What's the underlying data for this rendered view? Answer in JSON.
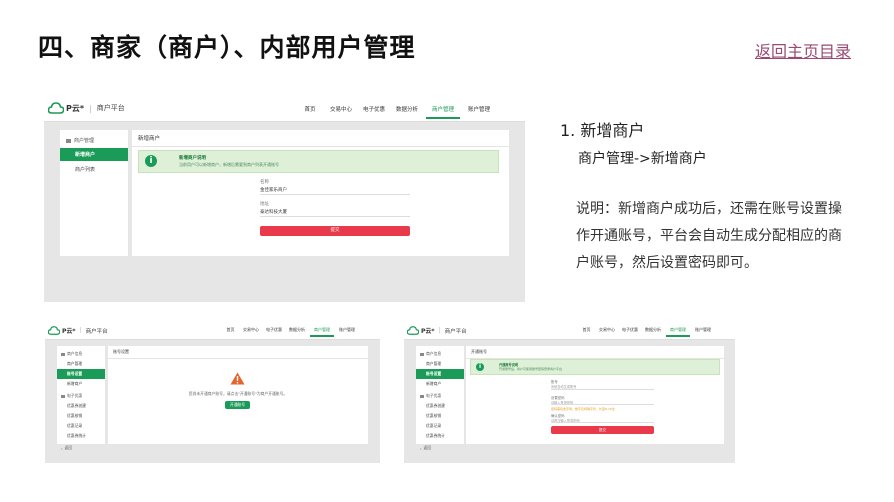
{
  "slide": {
    "title": "四、商家（商户）、内部用户管理",
    "back_link": "返回主页目录"
  },
  "app": {
    "logo": "P云*",
    "platform": "商户平台"
  },
  "top_nav": [
    "首页",
    "交易中心",
    "电子优惠",
    "数据分析",
    "商户管理",
    "账户管理"
  ],
  "top_nav_active": 4,
  "shot_main": {
    "sidebar_group": "商户管理",
    "sidebar_items": [
      "新增商户",
      "商户列表"
    ],
    "active_item": 0,
    "panel_title": "新增商户",
    "notice_title": "新增商户说明",
    "notice_desc": "当前用户可以新增商户，新增后需要到商户列表开通账号",
    "fields": [
      {
        "label": "名称",
        "value": "金佳家乐商户"
      },
      {
        "label": "地址",
        "value": "泰达科技大厦"
      }
    ],
    "submit_label": "提交"
  },
  "shot_left": {
    "sidebar_group": "商户信息",
    "sidebar_items": [
      "商户管理",
      "账号设置",
      "新增商户"
    ],
    "active_item": 1,
    "sidebar_group2": "电子优惠",
    "sidebar_items2": [
      "优惠券创建",
      "优惠核销",
      "优惠记录",
      "优惠券统计"
    ],
    "sidebar_footer": "返回",
    "panel_title": "账号设置",
    "warning_text": "您尚未开通商户账号，请点击\"开通账号\"为商户开通账号。",
    "button_label": "开通账号"
  },
  "shot_right": {
    "sidebar_group": "商户信息",
    "sidebar_items": [
      "商户管理",
      "账号设置",
      "新增商户"
    ],
    "active_item": 1,
    "sidebar_group2": "电子优惠",
    "sidebar_items2": [
      "优惠券创建",
      "优惠核销",
      "优惠记录",
      "优惠券统计"
    ],
    "sidebar_footer": "返回",
    "panel_title": "开通账号",
    "notice_title": "开通账号说明",
    "notice_desc": "开通账号后，商户可使用账号密码登录商户平台",
    "fields": [
      {
        "label": "账号",
        "value": "系统自动生成账号"
      },
      {
        "label": "设置密码",
        "value": "请输入登录密码"
      },
      {
        "label": "确认密码",
        "value": "请再次输入登录密码"
      }
    ],
    "hint": "密码需包含字母、数字及特殊字符，长度8-16位",
    "submit_label": "提交"
  },
  "step": {
    "title": "1. 新增商户",
    "path": "商户管理->新增商户",
    "desc": "说明：新增商户成功后，还需在账号设置操作开通账号，平台会自动生成分配相应的商户账号，然后设置密码即可。"
  },
  "colors": {
    "accent": "#1a9b58",
    "danger": "#e83a4a",
    "link": "#9a4a72"
  }
}
